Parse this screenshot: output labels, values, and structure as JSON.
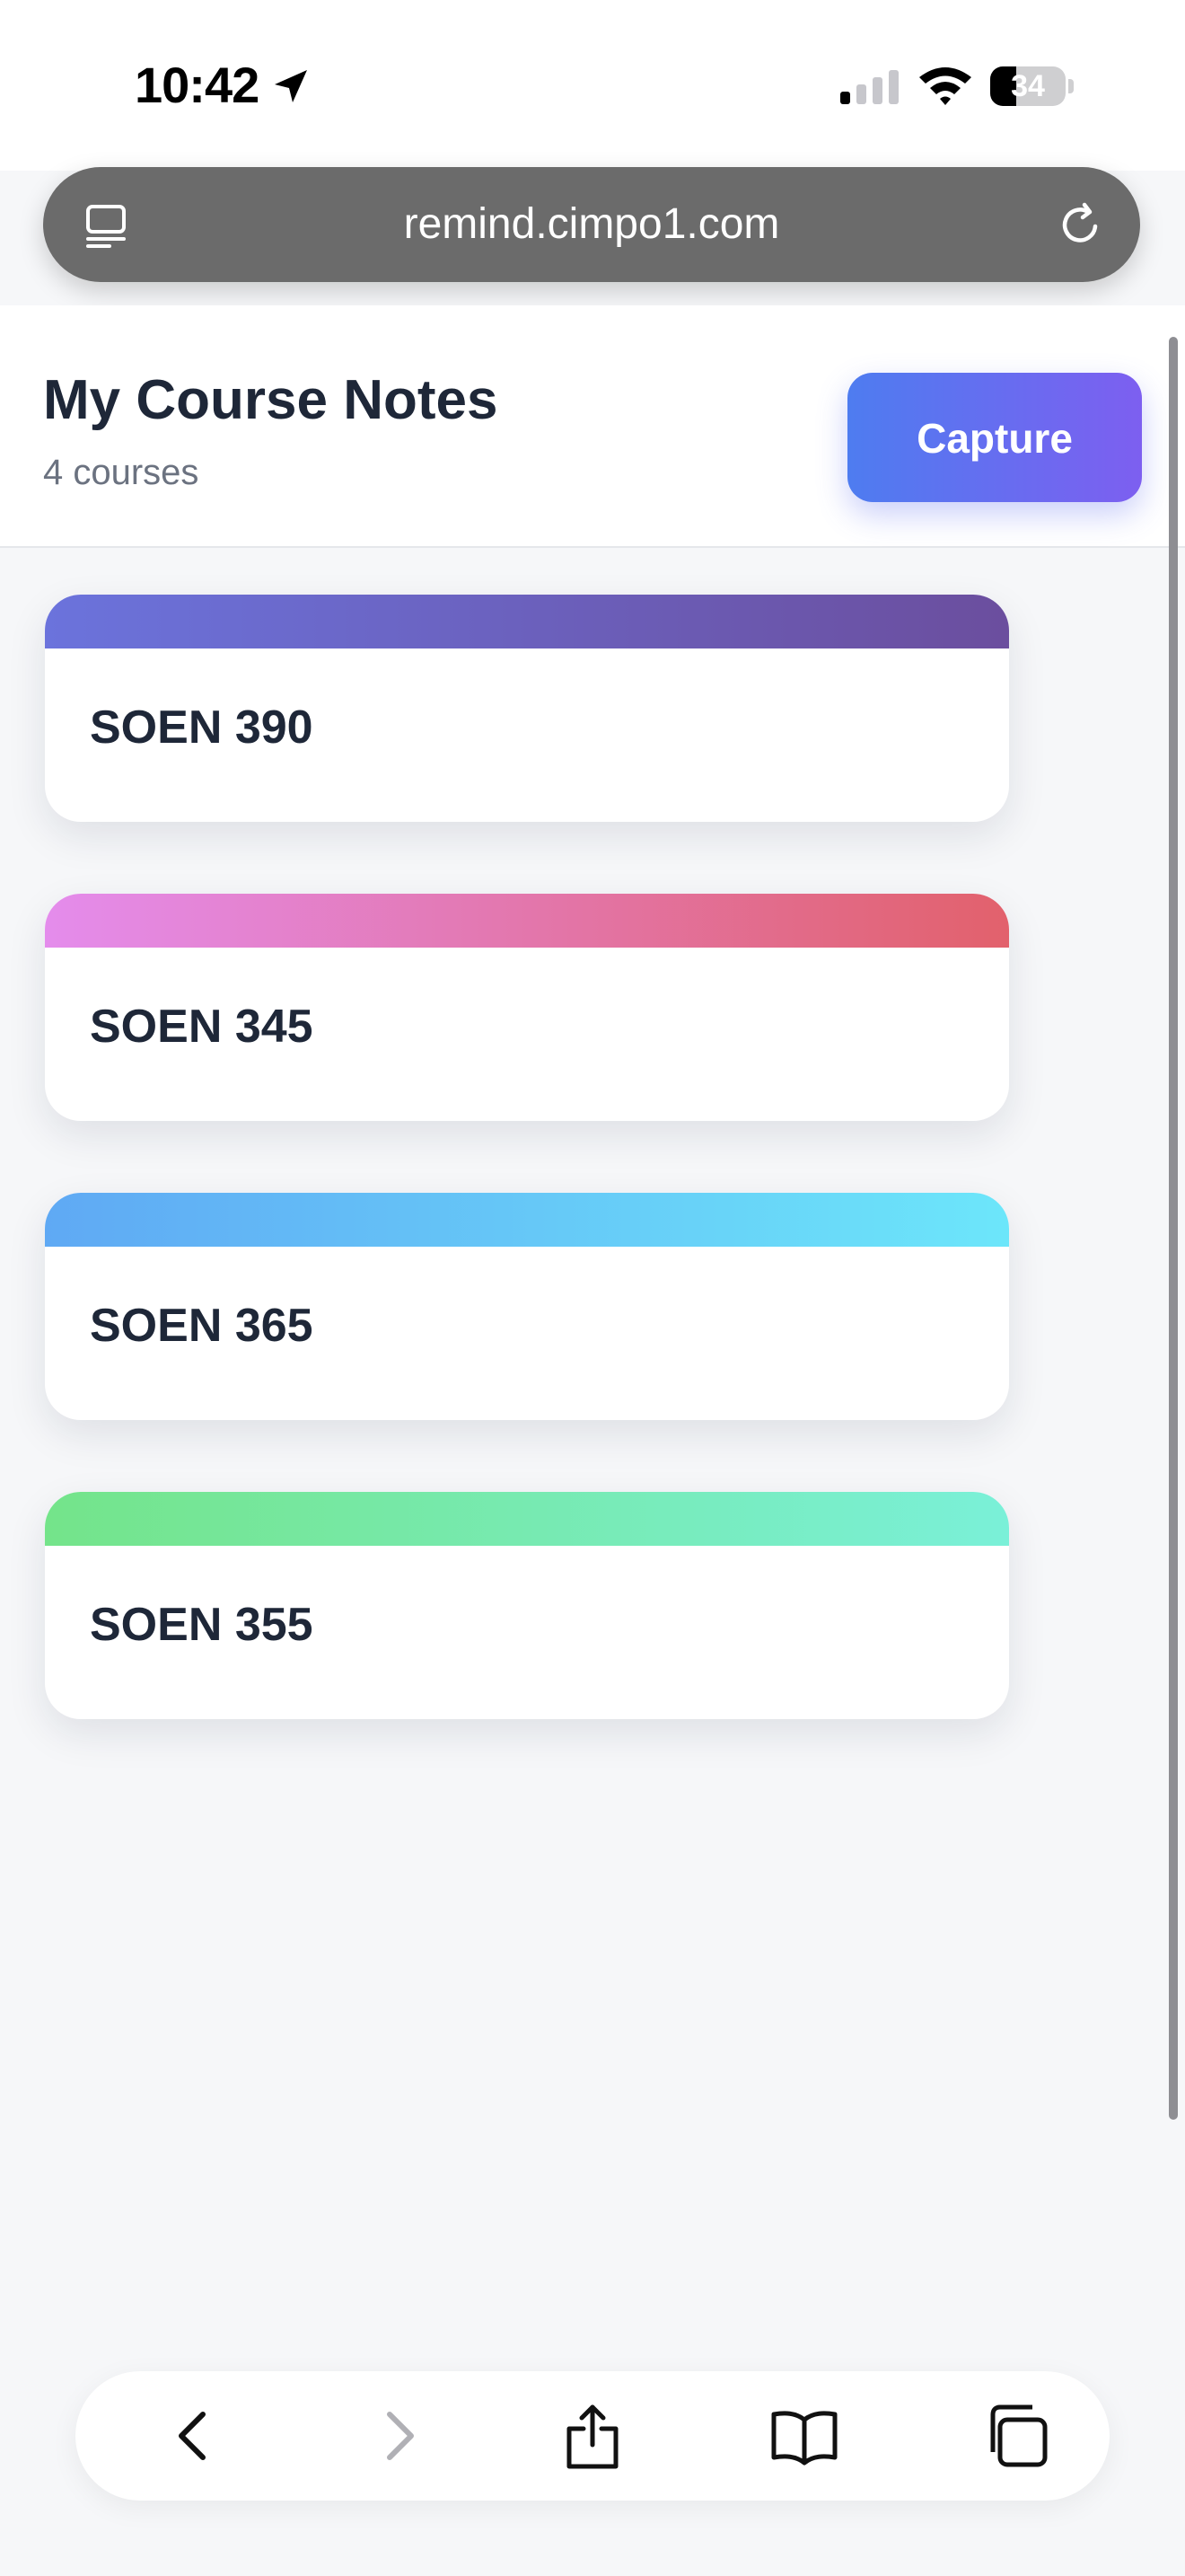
{
  "status_bar": {
    "time": "10:42",
    "battery_level": "34",
    "battery_fraction": 0.34,
    "icons": [
      "location-arrow-icon",
      "signal-icon",
      "wifi-icon",
      "battery-icon"
    ]
  },
  "browser": {
    "url": "remind.cimpo1.com",
    "icons": [
      "page-menu-icon",
      "reload-icon"
    ]
  },
  "header": {
    "title": "My Course Notes",
    "subtitle": "4 courses",
    "capture_label": "Capture"
  },
  "courses": [
    {
      "title": "SOEN 390",
      "color_start": "#6b73dc",
      "color_end": "#6b4e9e"
    },
    {
      "title": "SOEN 345",
      "color_start": "#e48cec",
      "color_end": "#e2616c"
    },
    {
      "title": "SOEN 365",
      "color_start": "#5fa9f4",
      "color_end": "#6ce6fa"
    },
    {
      "title": "SOEN 355",
      "color_start": "#74e48a",
      "color_end": "#7af0d8"
    }
  ],
  "toolbar": {
    "icons": [
      "back-icon",
      "forward-icon",
      "share-icon",
      "bookmarks-icon",
      "tabs-icon"
    ]
  },
  "colors": {
    "accent_start": "#4e7cf0",
    "accent_end": "#7d5ff0",
    "background": "#f6f7f9"
  }
}
